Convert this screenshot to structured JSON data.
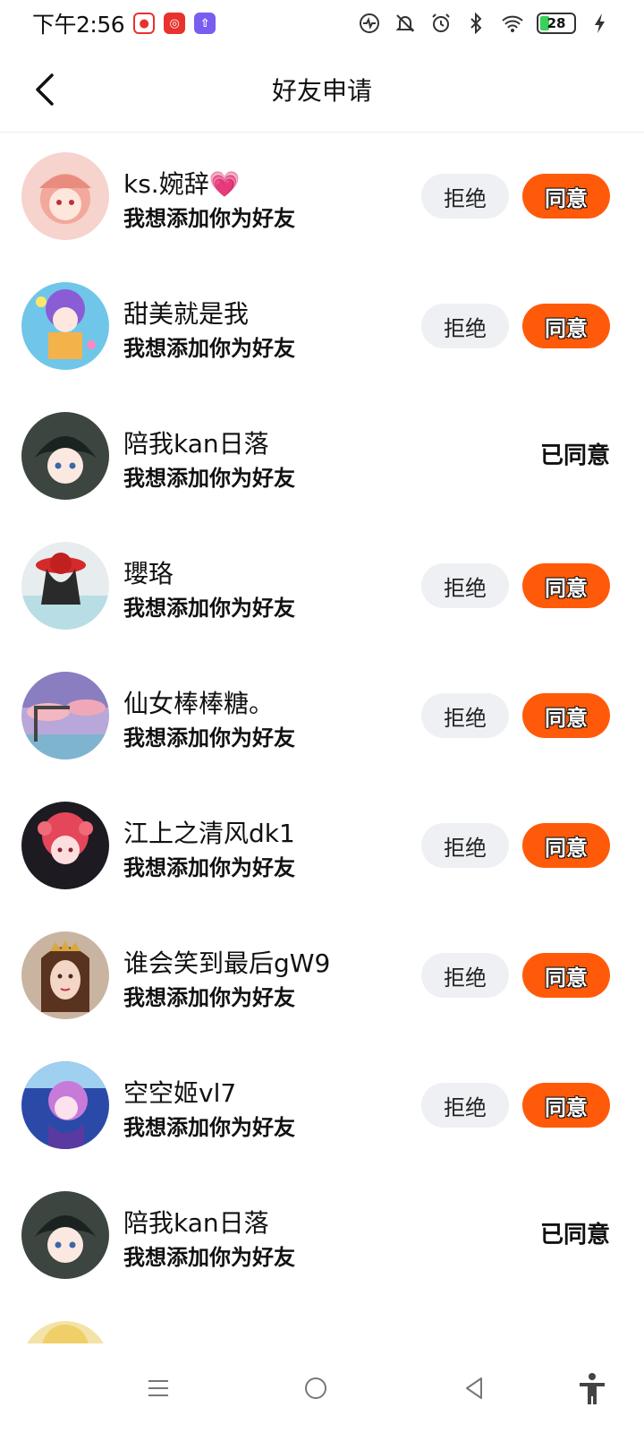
{
  "status_bar": {
    "time": "下午2:56",
    "battery": "28",
    "icons": [
      "app-icon-red",
      "app-icon-target",
      "app-icon-purple",
      "activity-icon",
      "mute-icon",
      "alarm-icon",
      "bluetooth-icon",
      "wifi-icon",
      "battery-icon",
      "charging-icon"
    ]
  },
  "header": {
    "title": "好友申请"
  },
  "buttons": {
    "reject": "拒绝",
    "accept": "同意",
    "accepted": "已同意"
  },
  "requests": [
    {
      "name": "ks.婉辞",
      "emoji": "💗",
      "message": "我想添加你为好友",
      "status": "pending"
    },
    {
      "name": "甜美就是我",
      "emoji": "",
      "message": "我想添加你为好友",
      "status": "pending"
    },
    {
      "name": "陪我kan日落",
      "emoji": "",
      "message": "我想添加你为好友",
      "status": "accepted"
    },
    {
      "name": "瓔珞",
      "emoji": "",
      "message": "我想添加你为好友",
      "status": "pending"
    },
    {
      "name": "仙女棒棒糖。",
      "emoji": "",
      "message": "我想添加你为好友",
      "status": "pending"
    },
    {
      "name": "江上之清风dk1",
      "emoji": "",
      "message": "我想添加你为好友",
      "status": "pending"
    },
    {
      "name": "谁会笑到最后gW9",
      "emoji": "",
      "message": "我想添加你为好友",
      "status": "pending"
    },
    {
      "name": "空空姬vl7",
      "emoji": "",
      "message": "我想添加你为好友",
      "status": "pending"
    },
    {
      "name": "陪我kan日落",
      "emoji": "",
      "message": "我想添加你为好友",
      "status": "accepted"
    }
  ],
  "colors": {
    "accent": "#ff5a0a",
    "reject_bg": "#eef0f4"
  },
  "nav_bar": {
    "icons": [
      "menu-icon",
      "home-icon",
      "back-icon",
      "accessibility-icon"
    ]
  }
}
